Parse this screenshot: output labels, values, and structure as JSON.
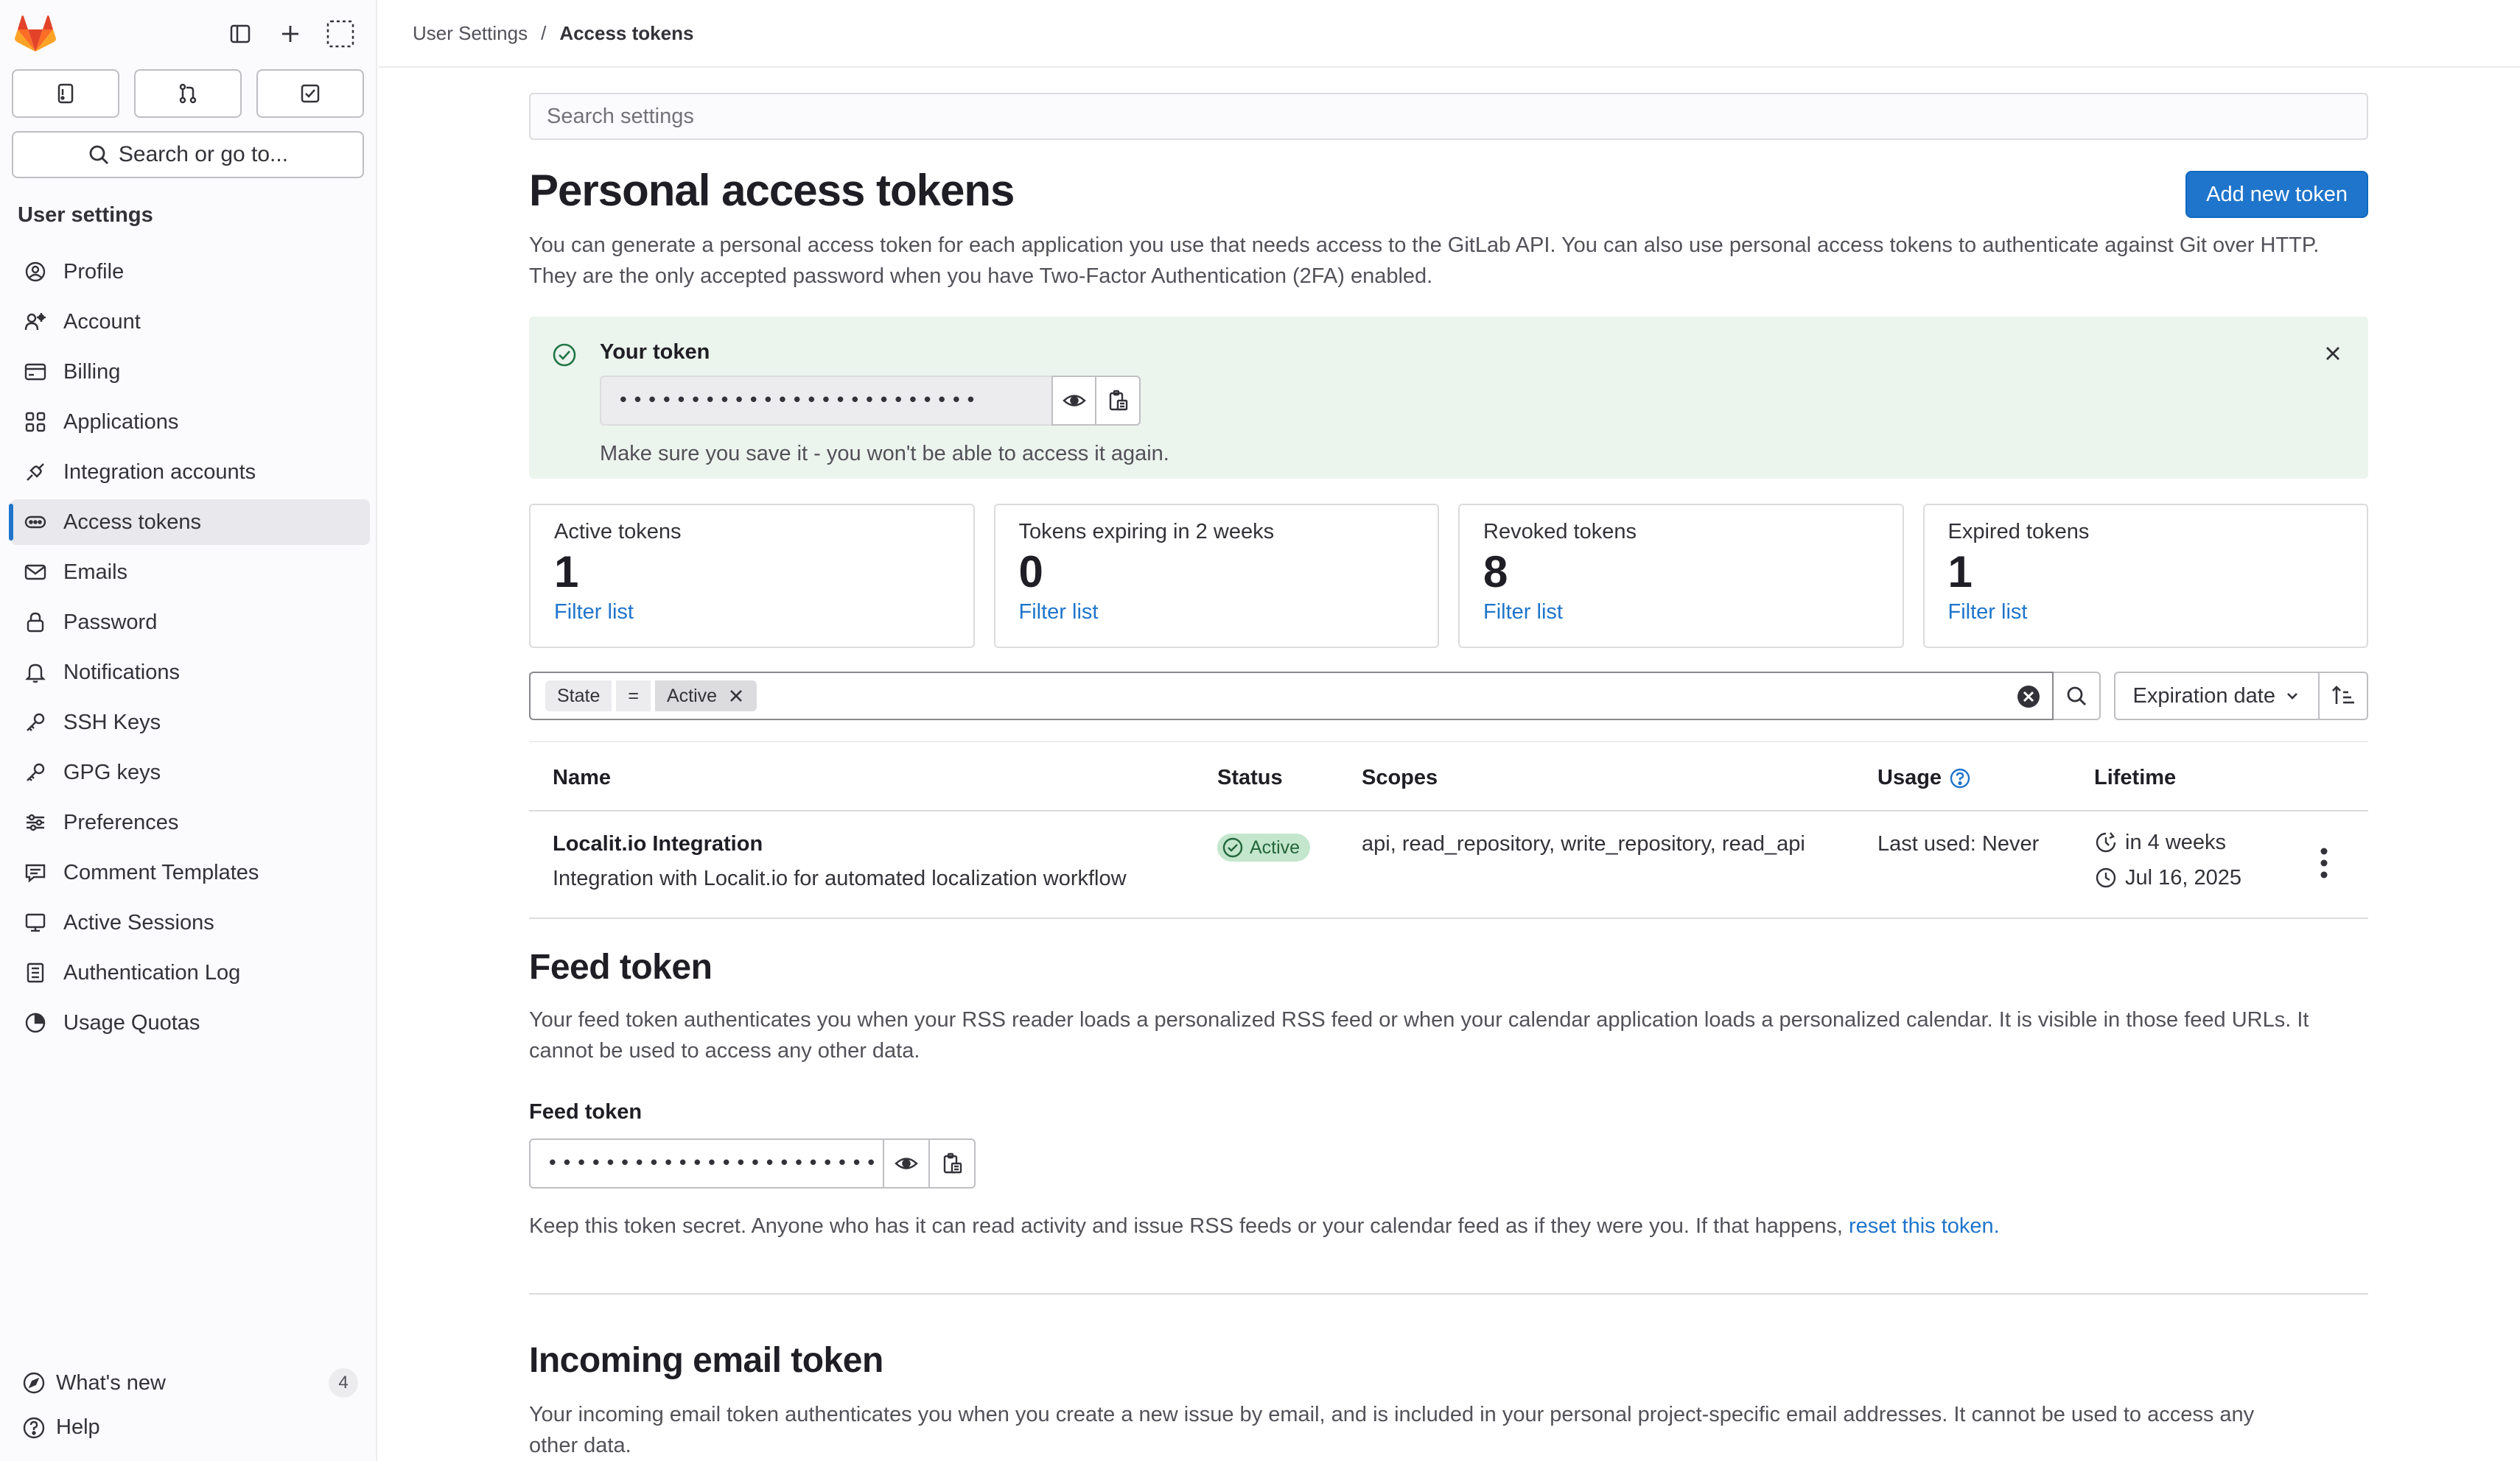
{
  "sidebar": {
    "search_label": "Search or go to...",
    "heading": "User settings",
    "items": [
      {
        "label": "Profile",
        "icon": "profile-icon"
      },
      {
        "label": "Account",
        "icon": "account-icon"
      },
      {
        "label": "Billing",
        "icon": "billing-icon"
      },
      {
        "label": "Applications",
        "icon": "applications-icon"
      },
      {
        "label": "Integration accounts",
        "icon": "integration-icon"
      },
      {
        "label": "Access tokens",
        "icon": "token-icon",
        "active": true
      },
      {
        "label": "Emails",
        "icon": "mail-icon"
      },
      {
        "label": "Password",
        "icon": "lock-icon"
      },
      {
        "label": "Notifications",
        "icon": "bell-icon"
      },
      {
        "label": "SSH Keys",
        "icon": "key-icon"
      },
      {
        "label": "GPG keys",
        "icon": "key-icon"
      },
      {
        "label": "Preferences",
        "icon": "preferences-icon"
      },
      {
        "label": "Comment Templates",
        "icon": "comment-icon"
      },
      {
        "label": "Active Sessions",
        "icon": "monitor-icon"
      },
      {
        "label": "Authentication Log",
        "icon": "log-icon"
      },
      {
        "label": "Usage Quotas",
        "icon": "quota-icon"
      }
    ],
    "whats_new": "What's new",
    "whats_new_count": "4",
    "help": "Help"
  },
  "breadcrumb": {
    "parent": "User Settings",
    "separator": "/",
    "current": "Access tokens"
  },
  "main": {
    "search_placeholder": "Search settings",
    "title": "Personal access tokens",
    "add_button": "Add new token",
    "description_1": "You can generate a personal access token for each application you use that needs access to the GitLab API. You can also use personal access tokens to authenticate against Git over HTTP.",
    "description_2": "They are the only accepted password when you have Two-Factor Authentication (2FA) enabled.",
    "alert": {
      "title": "Your token",
      "masked_value": "•••••••••••••••••••••••••",
      "note": "Make sure you save it - you won't be able to access it again."
    },
    "stats": [
      {
        "label": "Active tokens",
        "value": "1",
        "link": "Filter list"
      },
      {
        "label": "Tokens expiring in 2 weeks",
        "value": "0",
        "link": "Filter list"
      },
      {
        "label": "Revoked tokens",
        "value": "8",
        "link": "Filter list"
      },
      {
        "label": "Expired tokens",
        "value": "1",
        "link": "Filter list"
      }
    ],
    "filter": {
      "field": "State",
      "operator": "=",
      "value": "Active",
      "sort_label": "Expiration date"
    },
    "table": {
      "headers": {
        "name": "Name",
        "status": "Status",
        "scopes": "Scopes",
        "usage": "Usage",
        "lifetime": "Lifetime"
      },
      "rows": [
        {
          "name": "Localit.io Integration",
          "description": "Integration with Localit.io for automated localization workflow",
          "status": "Active",
          "scopes": "api, read_repository, write_repository, read_api",
          "usage": "Last used: Never",
          "expires_in": "in 4 weeks",
          "expires_on": "Jul 16, 2025"
        }
      ]
    }
  },
  "feed": {
    "title": "Feed token",
    "description_1": "Your feed token authenticates you when your RSS reader loads a personalized RSS feed or when your calendar application loads a personalized calendar. It is visible in those feed URLs. It",
    "description_2": "cannot be used to access any other data.",
    "field_label": "Feed token",
    "masked_value": "•••••••••••••••••••••••••",
    "note": "Keep this token secret. Anyone who has it can read activity and issue RSS feeds or your calendar feed as if they were you. If that happens,",
    "reset_link": "reset this token",
    "note_end": "."
  },
  "incoming": {
    "title": "Incoming email token",
    "description_1": "Your incoming email token authenticates you when you create a new issue by email, and is included in your personal project-specific email addresses. It cannot be used to access any",
    "description_2": "other data."
  },
  "colors": {
    "accent": "#1f75cb",
    "success_bg": "#ecf4ee",
    "badge_bg": "#c3e6cd",
    "badge_text": "#24663b",
    "logo_orange": "#e24329"
  }
}
